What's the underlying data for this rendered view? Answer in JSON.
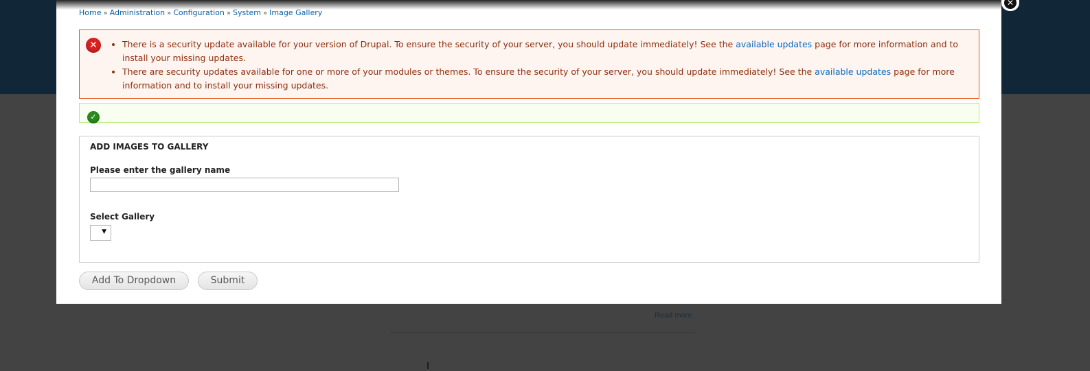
{
  "background": {
    "read_more": "Read more"
  },
  "breadcrumb": [
    {
      "label": "Home"
    },
    {
      "label": "Administration"
    },
    {
      "label": "Configuration"
    },
    {
      "label": "System"
    },
    {
      "label": "Image Gallery"
    }
  ],
  "breadcrumb_separator": "»",
  "messages": {
    "error": {
      "items": [
        {
          "before": "There is a security update available for your version of Drupal. To ensure the security of your server, you should update immediately! See the ",
          "link": "available updates",
          "after": " page for more information and to install your missing updates."
        },
        {
          "before": "There are security updates available for one or more of your modules or themes. To ensure the security of your server, you should update immediately! See the ",
          "link": "available updates",
          "after": " page for more information and to install your missing updates."
        }
      ],
      "icon": "error-x-icon",
      "color": "#ed541d"
    },
    "status": {
      "icon": "check-icon",
      "color": "#2b8a1d"
    }
  },
  "form": {
    "legend": "ADD IMAGES TO GALLERY",
    "gallery_name_label": "Please enter the gallery name",
    "gallery_name_value": "",
    "select_label": "Select Gallery",
    "select_value": "",
    "add_button": "Add To Dropdown",
    "submit_button": "Submit"
  },
  "close_icon": "close-icon"
}
